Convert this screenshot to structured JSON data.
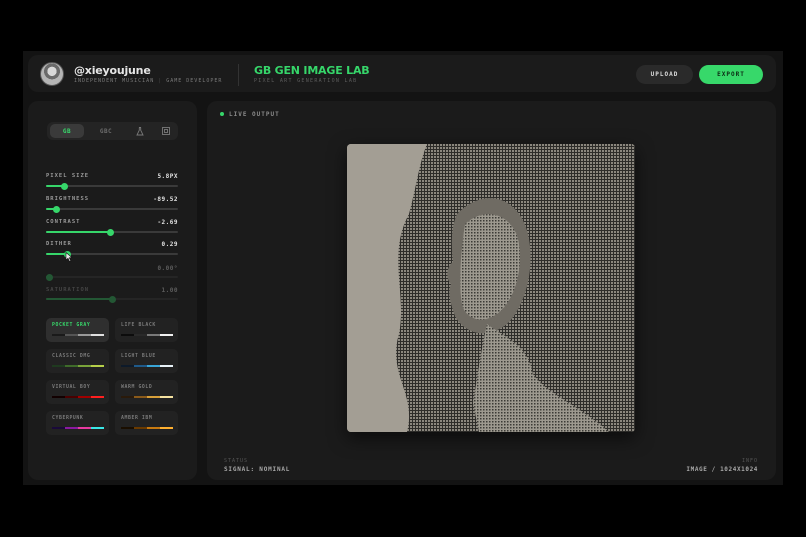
{
  "header": {
    "username": "@xieyoujune",
    "roles": [
      "INDEPENDENT MUSICIAN",
      "GAME DEVELOPER"
    ],
    "app_title": "GB GEN IMAGE LAB",
    "app_subtitle": "PIXEL ART GENERATION LAB",
    "upload_label": "UPLOAD",
    "export_label": "EXPORT"
  },
  "tabs": [
    {
      "label": "GB",
      "active": true
    },
    {
      "label": "GBC",
      "active": false
    },
    {
      "icon": "flask-icon"
    },
    {
      "icon": "grid-icon"
    }
  ],
  "sliders": [
    {
      "label": "PIXEL SIZE",
      "value": "5.8PX",
      "level": 0.14,
      "enabled": true
    },
    {
      "label": "BRIGHTNESS",
      "value": "-89.52",
      "level": 0.08,
      "enabled": true
    },
    {
      "label": "CONTRAST",
      "value": "-2.69",
      "level": 0.49,
      "enabled": true
    },
    {
      "label": "DITHER",
      "value": "0.29",
      "level": 0.16,
      "enabled": true
    },
    {
      "label": "",
      "value": "0.00°",
      "level": 0.03,
      "enabled": false
    },
    {
      "label": "SATURATION",
      "value": "1.00",
      "level": 0.5,
      "enabled": false
    }
  ],
  "palettes": [
    {
      "name": "POCKET GRAY",
      "selected": true,
      "colors": [
        "#1a1a1a",
        "#555555",
        "#9a9a9a",
        "#e0e0e0"
      ]
    },
    {
      "name": "LIFE BLACK",
      "selected": false,
      "colors": [
        "#0c0c0c",
        "#2a2a2a",
        "#7a7a7a",
        "#f0f0f0"
      ]
    },
    {
      "name": "CLASSIC DMG",
      "selected": false,
      "colors": [
        "#1f3a1f",
        "#3f6b2a",
        "#7aa33a",
        "#b7d04a"
      ]
    },
    {
      "name": "LIGHT BLUE",
      "selected": false,
      "colors": [
        "#0d1a2a",
        "#1f5a8a",
        "#3aa6d8",
        "#e8f2f8"
      ]
    },
    {
      "name": "VIRTUAL BOY",
      "selected": false,
      "colors": [
        "#120000",
        "#4a0000",
        "#a00000",
        "#ff2020"
      ]
    },
    {
      "name": "WARM GOLD",
      "selected": false,
      "colors": [
        "#2a1a0a",
        "#8a5a1a",
        "#d8a03a",
        "#f5e2a0"
      ]
    },
    {
      "name": "CYBERPUNK",
      "selected": false,
      "colors": [
        "#1a0a3a",
        "#8a1aa0",
        "#e83aa0",
        "#3ae8e8"
      ]
    },
    {
      "name": "AMBER IBM",
      "selected": false,
      "colors": [
        "#1a0e00",
        "#6a3a00",
        "#c87a10",
        "#ffb030"
      ]
    }
  ],
  "preview": {
    "live_label": "LIVE OUTPUT",
    "status_key": "STATUS",
    "status_value": "SIGNAL: NOMINAL",
    "info_key": "INFO",
    "info_value": "IMAGE / 1024X1024"
  },
  "colors": {
    "accent": "#36d66a",
    "panel": "#1b1b1b",
    "background": "#131313"
  }
}
